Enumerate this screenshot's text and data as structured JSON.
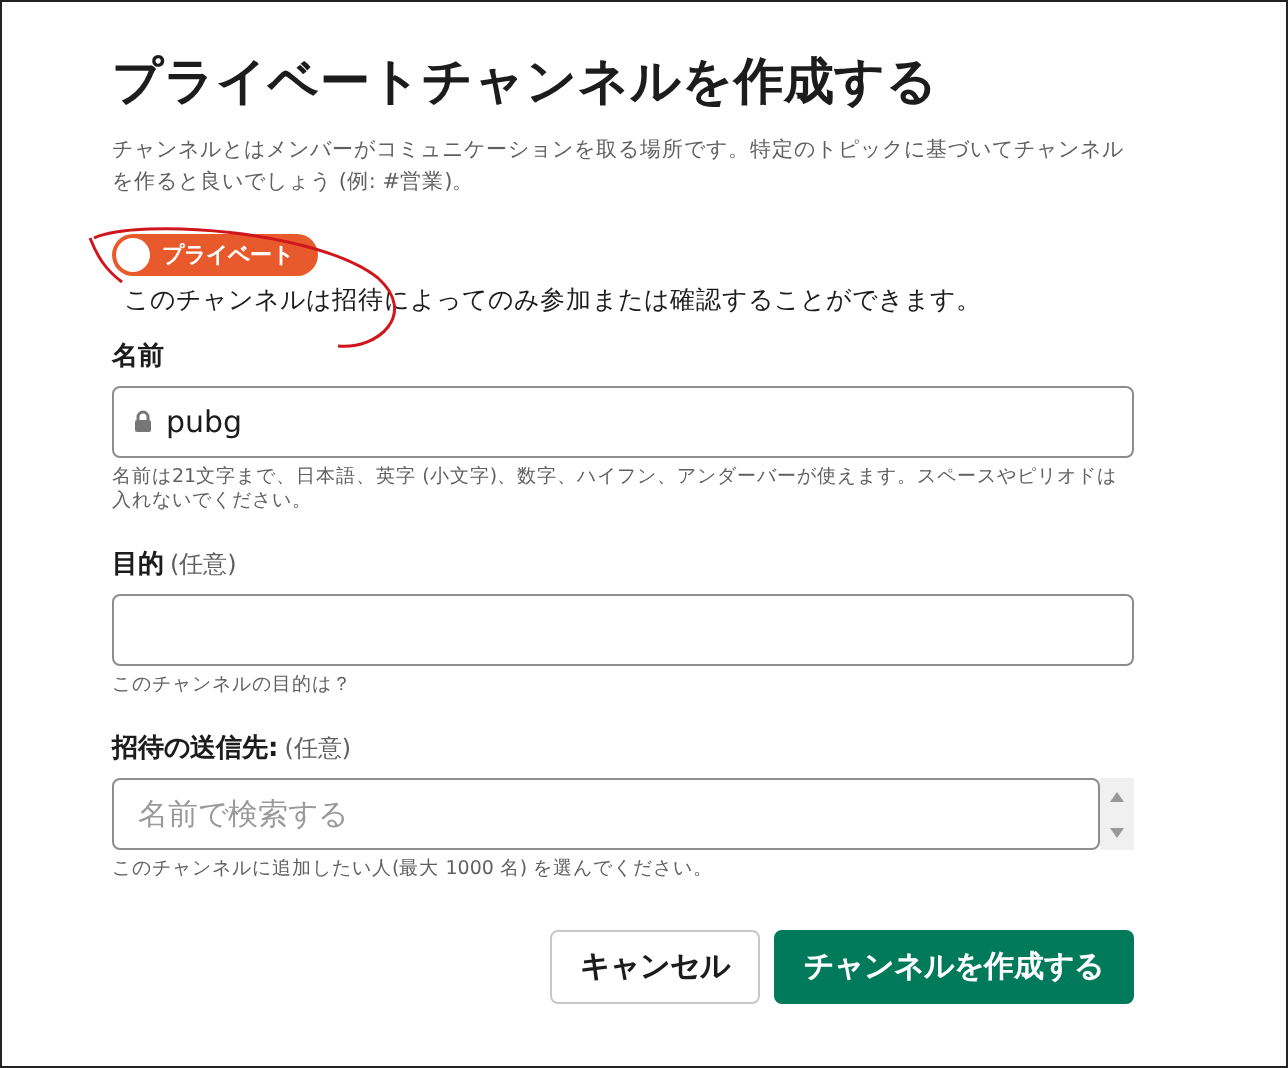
{
  "title": "プライベートチャンネルを作成する",
  "description": "チャンネルとはメンバーがコミュニケーションを取る場所です。特定のトピックに基づいてチャンネルを作ると良いでしょう (例: #営業)。",
  "privacy_toggle": {
    "label": "プライベート",
    "on": true,
    "caption": "このチャンネルは招待によってのみ参加または確認することができます。"
  },
  "fields": [
    {
      "kind": "locked",
      "label": "名前",
      "value": "pubg",
      "hint": "名前は21文字まで、日本語、英字 (小文字)、数字、ハイフン、アンダーバーが使えます。スペースやピリオドは入れないでください。"
    },
    {
      "kind": "text",
      "label": "目的",
      "optional": "(任意)",
      "hint": "このチャンネルの目的は？"
    },
    {
      "kind": "search",
      "label": "招待の送信先:",
      "optional": "(任意)",
      "placeholder": "名前で検索する",
      "hint": "このチャンネルに追加したい人(最大 1000 名) を選んでください。"
    }
  ],
  "buttons": [
    {
      "kind": "secondary",
      "label": "キャンセル"
    },
    {
      "kind": "primary",
      "label": "チャンネルを作成する"
    }
  ]
}
